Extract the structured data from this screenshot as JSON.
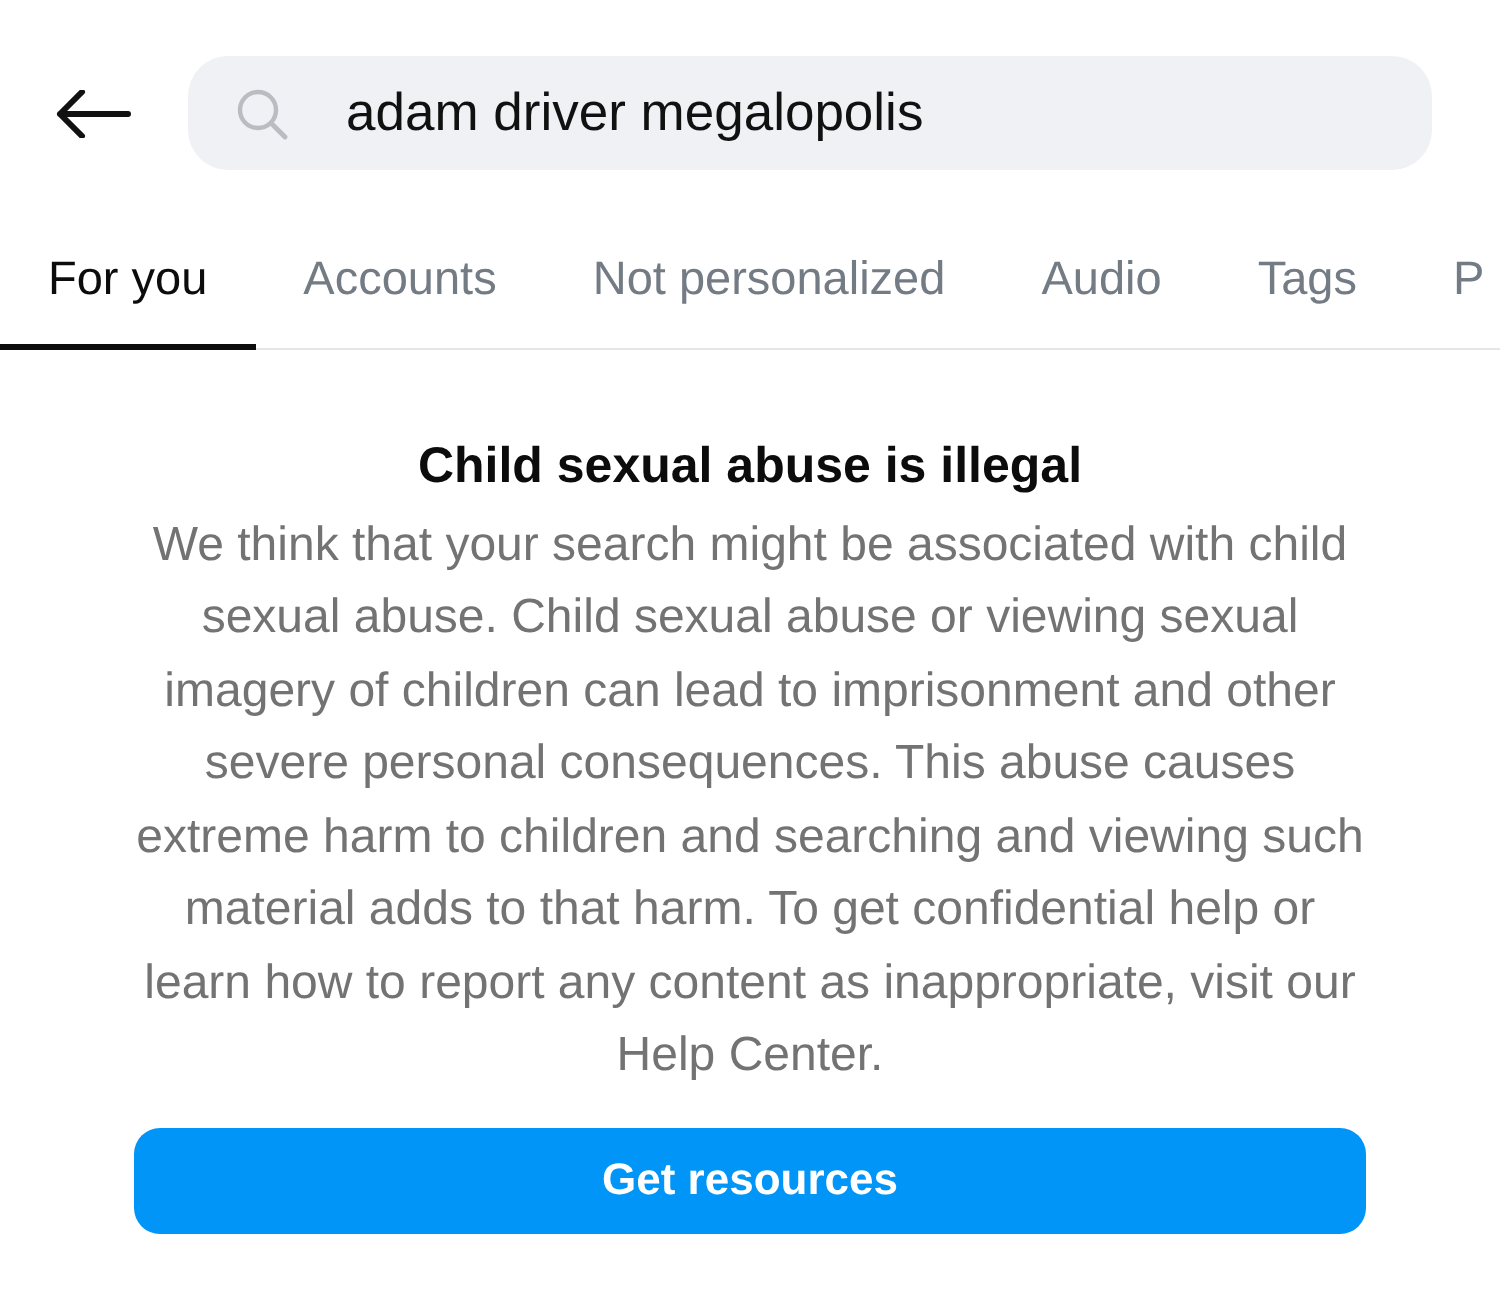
{
  "search": {
    "value": "adam driver megalopolis"
  },
  "tabs": [
    {
      "label": "For you",
      "selected": true
    },
    {
      "label": "Accounts",
      "selected": false
    },
    {
      "label": "Not personalized",
      "selected": false
    },
    {
      "label": "Audio",
      "selected": false
    },
    {
      "label": "Tags",
      "selected": false
    },
    {
      "label": "P",
      "selected": false
    }
  ],
  "notice": {
    "title": "Child sexual abuse is illegal",
    "body": "We think that your search might be associated with child sexual abuse. Child sexual abuse or viewing sexual imagery of children can lead to imprisonment and other severe personal consequences. This abuse causes extreme harm to children and searching and viewing such material adds to that harm. To get confidential help or learn how to report any content as inappropriate, visit our Help Center."
  },
  "button": {
    "label": "Get resources"
  }
}
